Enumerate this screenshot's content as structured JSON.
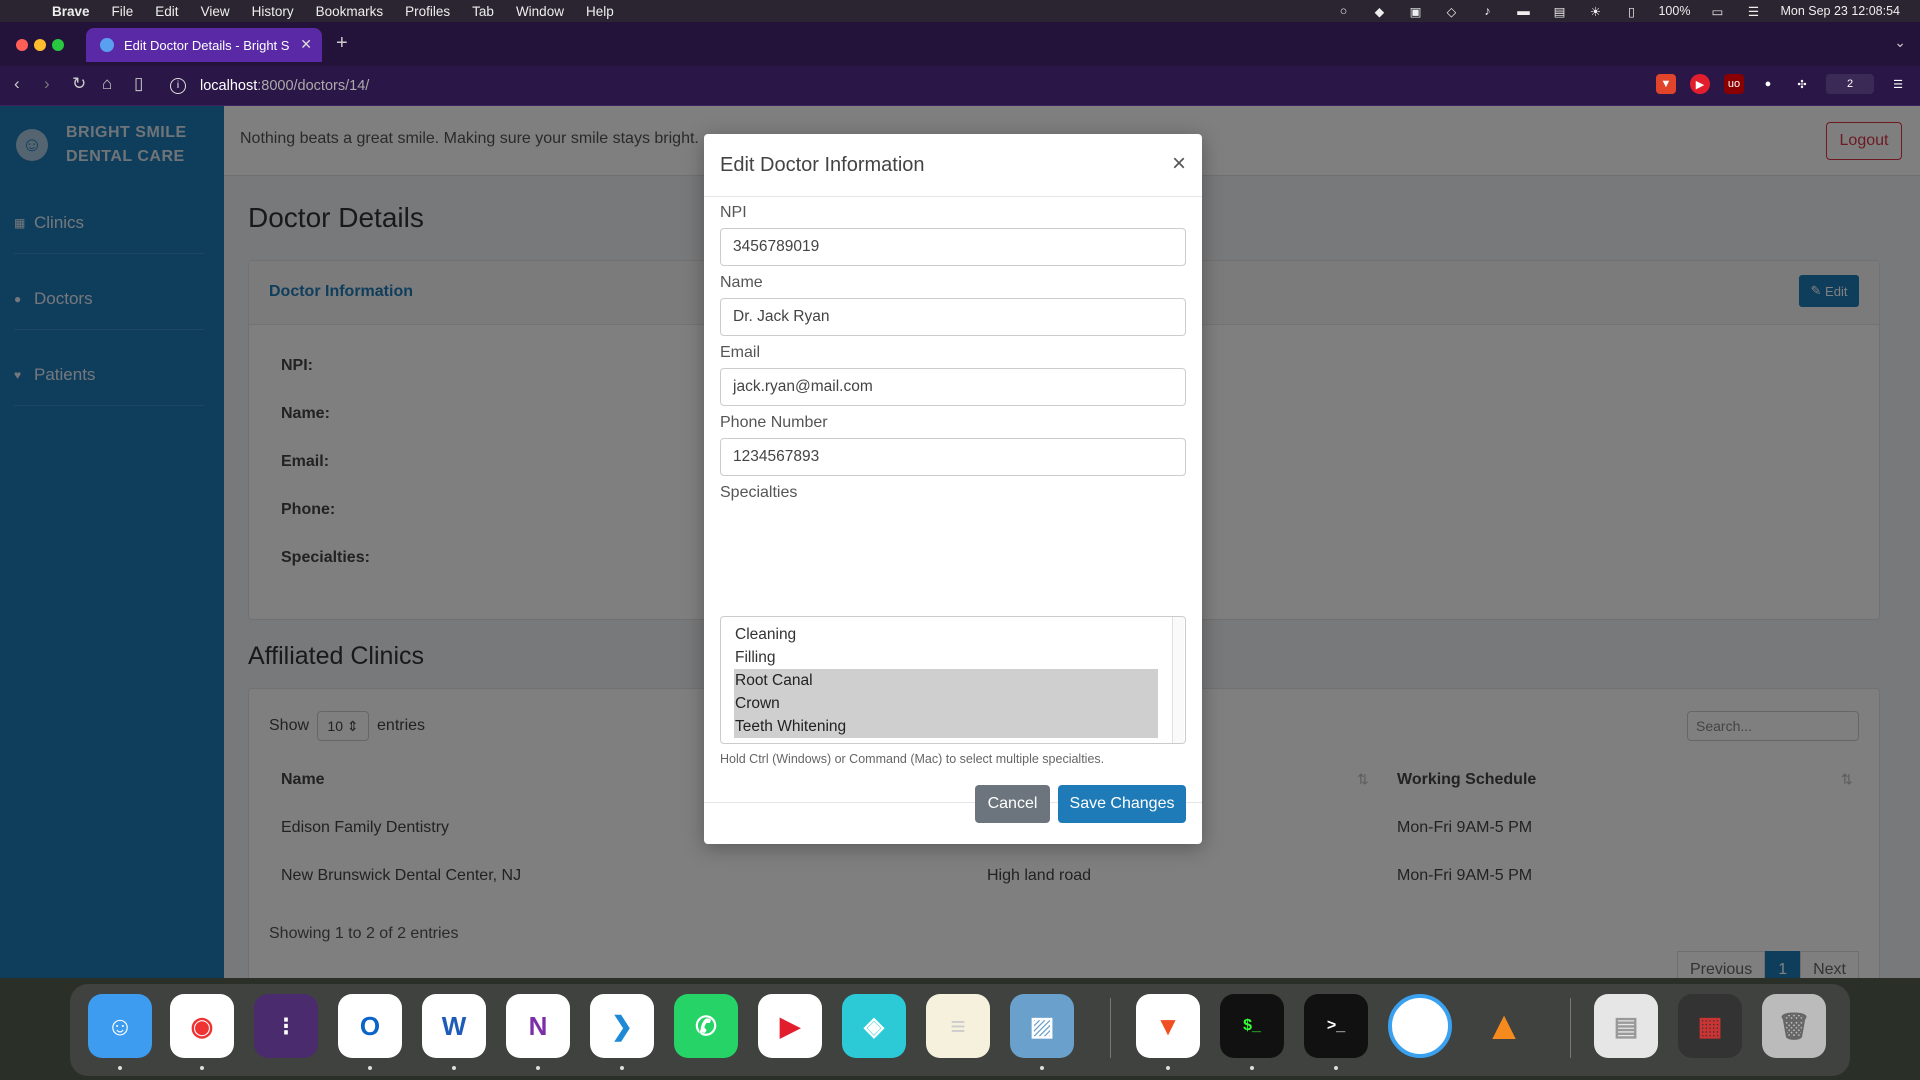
{
  "menubar": {
    "app": "Brave",
    "items": [
      "File",
      "Edit",
      "View",
      "History",
      "Bookmarks",
      "Profiles",
      "Tab",
      "Window",
      "Help"
    ],
    "battery": "100%",
    "datetime": "Mon Sep 23  12:08:54"
  },
  "browser": {
    "tab_title": "Edit Doctor Details - Bright S",
    "url_host": "localhost",
    "url_rest": ":8000/doctors/14/",
    "wallet_count": "2"
  },
  "sidebar": {
    "brand_line1": "BRIGHT SMILE",
    "brand_line2": "DENTAL CARE",
    "items": [
      {
        "label": "Clinics",
        "icon": "hospital-icon"
      },
      {
        "label": "Doctors",
        "icon": "user-icon"
      },
      {
        "label": "Patients",
        "icon": "tooth-icon"
      }
    ]
  },
  "topbar": {
    "tagline": "Nothing beats a great smile. Making sure your smile stays bright.",
    "logout": "Logout"
  },
  "doctor_page": {
    "title": "Doctor Details",
    "card_title": "Doctor Information",
    "edit_label": "Edit",
    "fields": [
      "NPI:",
      "Name:",
      "Email:",
      "Phone:",
      "Specialties:"
    ]
  },
  "clinics": {
    "title": "Affiliated Clinics",
    "show_label": "Show",
    "page_size": "10",
    "entries_label": "entries",
    "search_placeholder": "Search...",
    "columns": [
      "Name",
      "Working Schedule"
    ],
    "rows": [
      {
        "name": "Edison Family Dentistry",
        "address": "",
        "schedule": "Mon-Fri 9AM-5 PM"
      },
      {
        "name": "New Brunswick Dental Center, NJ",
        "address": "High land road",
        "schedule": "Mon-Fri 9AM-5 PM"
      }
    ],
    "info": "Showing 1 to 2 of 2 entries",
    "pager": {
      "prev": "Previous",
      "page": "1",
      "next": "Next"
    }
  },
  "modal": {
    "title": "Edit Doctor Information",
    "close": "×",
    "npi_label": "NPI",
    "npi_value": "3456789019",
    "name_label": "Name",
    "name_value": "Dr. Jack Ryan",
    "email_label": "Email",
    "email_value": "jack.ryan@mail.com",
    "phone_label": "Phone Number",
    "phone_value": "1234567893",
    "specialties_label": "Specialties",
    "specialties": [
      {
        "label": "Cleaning",
        "selected": false
      },
      {
        "label": "Filling",
        "selected": false
      },
      {
        "label": "Root Canal",
        "selected": true
      },
      {
        "label": "Crown",
        "selected": true
      },
      {
        "label": "Teeth Whitening",
        "selected": true
      }
    ],
    "hint": "Hold Ctrl (Windows) or Command (Mac) to select multiple specialties.",
    "cancel": "Cancel",
    "save": "Save Changes"
  },
  "dock": {
    "apps": [
      "Finder",
      "Chrome",
      "Launchpad",
      "Outlook",
      "Word",
      "OneNote",
      "VS Code",
      "WhatsApp",
      "YouTube",
      "Setapp",
      "Notes",
      "Preview",
      "Brave",
      "iTerm",
      "Terminal",
      "Browser",
      "VLC",
      "Documents",
      "Screens",
      "Trash"
    ]
  }
}
